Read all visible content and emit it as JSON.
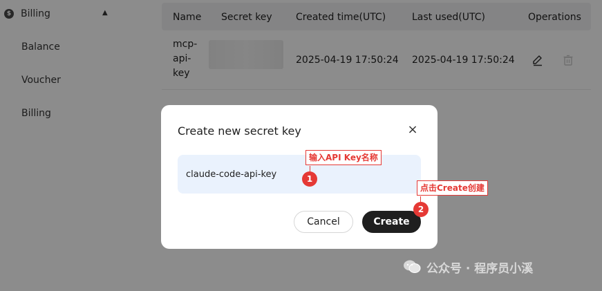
{
  "sidebar": {
    "billing_title": "Billing",
    "billing_icon": "$",
    "items": [
      {
        "label": "Balance"
      },
      {
        "label": "Voucher"
      },
      {
        "label": "Billing"
      }
    ]
  },
  "table": {
    "headers": [
      "Name",
      "Secret key",
      "Created time(UTC)",
      "Last used(UTC)",
      "Operations"
    ],
    "rows": [
      {
        "name_lines": [
          "mcp-",
          "api-",
          "key"
        ],
        "secret_key": "",
        "created": "2025-04-19 17:50:24",
        "last_used": "2025-04-19 17:50:24"
      }
    ]
  },
  "modal": {
    "title": "Create new secret key",
    "close_icon": "×",
    "input_value": "claude-code-api-key",
    "cancel_label": "Cancel",
    "create_label": "Create"
  },
  "annotations": [
    {
      "label": "输入API Key名称",
      "number": "1"
    },
    {
      "label": "点击Create创建",
      "number": "2"
    }
  ],
  "watermark": "公众号 · 程序员小溪",
  "colors": {
    "overlay": "#00000073",
    "create_button": "#1f1f1f",
    "input_bg": "#eaf2fd",
    "annotation": "#e53935"
  }
}
